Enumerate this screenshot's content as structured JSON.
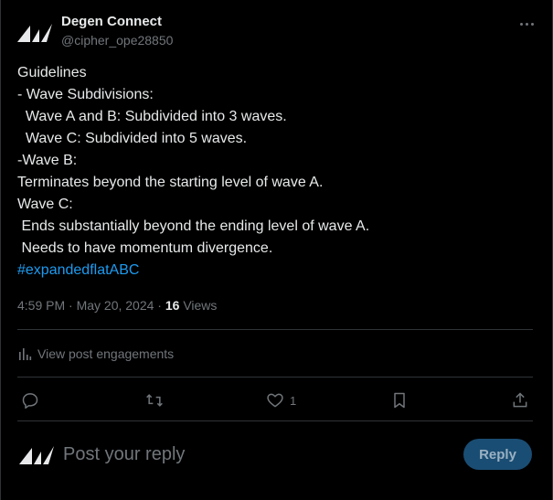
{
  "author": {
    "display_name": "Degen Connect",
    "handle": "@cipher_ope28850"
  },
  "post": {
    "lines": [
      "Guidelines",
      "- Wave Subdivisions:",
      "  Wave A and B: Subdivided into 3 waves.",
      "  Wave C: Subdivided into 5 waves.",
      "-Wave B:",
      "Terminates beyond the starting level of wave A.",
      "Wave C:",
      " Ends substantially beyond the ending level of wave A.",
      " Needs to have momentum divergence."
    ],
    "hashtag": "#expandedflatABC"
  },
  "meta": {
    "timestamp": "4:59 PM · May 20, 2024 · ",
    "views_count": "16",
    "views_label": " Views"
  },
  "engagements": {
    "label": "View post engagements"
  },
  "actions": {
    "like_count": "1"
  },
  "reply": {
    "placeholder": "Post your reply",
    "button_label": "Reply"
  },
  "colors": {
    "background": "#000000",
    "accent": "#1d9bf0",
    "muted_text": "#71767b",
    "reply_button": "#1a4d73"
  },
  "icons": [
    "logo-mark-icon",
    "more-icon",
    "analytics-icon",
    "reply-icon",
    "retweet-icon",
    "heart-icon",
    "bookmark-icon",
    "share-icon"
  ]
}
